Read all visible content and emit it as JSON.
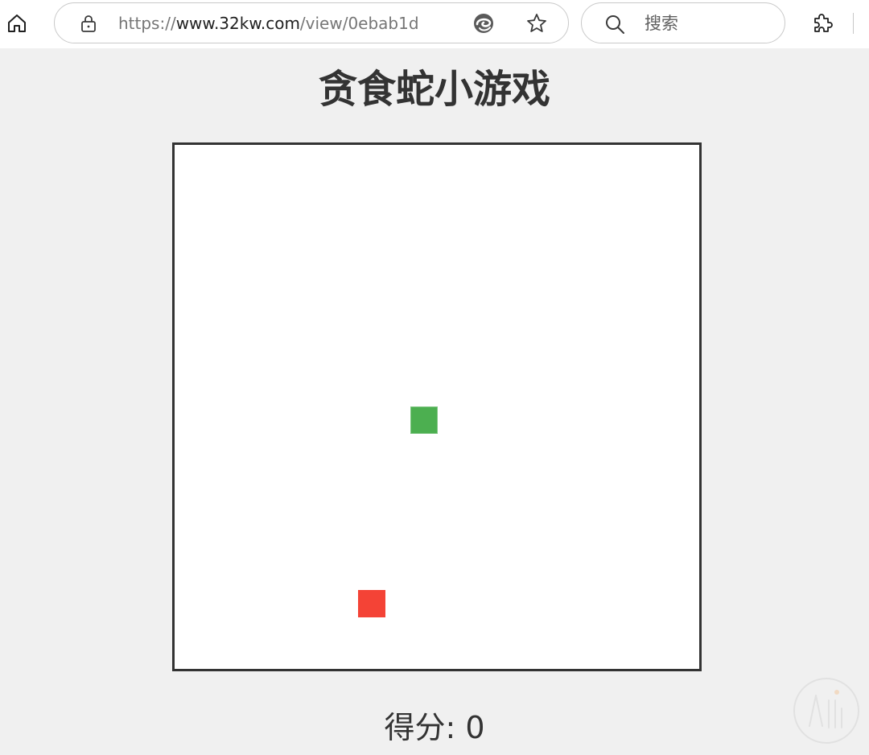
{
  "browser": {
    "url_prefix": "https://",
    "url_host": "www.32kw.com",
    "url_path": "/view/0ebab1d",
    "search_placeholder": "搜索"
  },
  "icons": {
    "home": "home-icon",
    "lock": "lock-icon",
    "edge": "edge-icon",
    "favorite": "star-icon",
    "search": "search-icon",
    "extensions": "puzzle-icon"
  },
  "game": {
    "title": "贪食蛇小游戏",
    "score_label": "得分",
    "score_separator": ": ",
    "score_value": "0",
    "grid_cols": 20,
    "grid_rows": 20,
    "snake": [
      {
        "col": 9,
        "row": 10
      }
    ],
    "food": {
      "col": 7,
      "row": 17
    }
  },
  "colors": {
    "page_background": "#f0f0f0",
    "board_background": "#ffffff",
    "board_border": "#333333",
    "snake": "#4caf50",
    "food": "#f44336",
    "text": "#333333"
  }
}
